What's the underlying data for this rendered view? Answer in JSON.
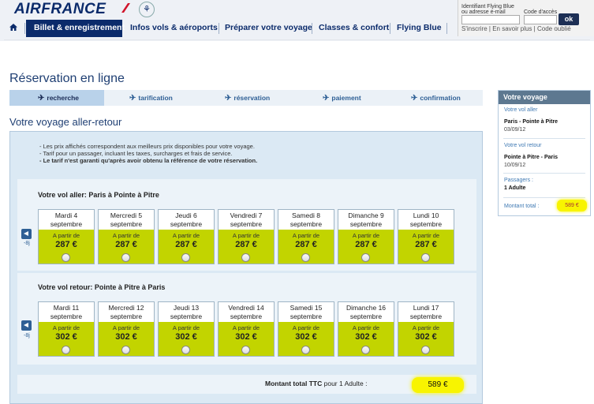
{
  "brand": {
    "logo_text": "AIRFRANCE"
  },
  "login": {
    "id_label": "Identifiant Flying Blue ou adresse e-mail",
    "code_label": "Code d'accès",
    "ok_label": "ok",
    "links": [
      "S'inscrire",
      "En savoir plus",
      "Code oublié"
    ]
  },
  "nav": {
    "home_icon": "home-icon",
    "items": [
      {
        "label": "Billet & enregistrement"
      },
      {
        "label": "Infos vols & aéroports"
      },
      {
        "label": "Préparer votre voyage"
      },
      {
        "label": "Classes & confort"
      },
      {
        "label": "Flying Blue"
      }
    ]
  },
  "page_title": "Réservation en ligne",
  "steps": [
    {
      "label": "recherche"
    },
    {
      "label": "tarification"
    },
    {
      "label": "réservation"
    },
    {
      "label": "paiement"
    },
    {
      "label": "confirmation"
    }
  ],
  "section_title": "Votre voyage aller-retour",
  "info": [
    "- Les prix affichés correspondent aux meilleurs prix disponibles pour votre voyage.",
    "- Tarif pour un passager, incluant les taxes, surcharges et frais de service.",
    "- Le tarif n'est garanti qu'après avoir obtenu la référence de votre réservation."
  ],
  "outbound": {
    "title": "Votre vol aller: Paris à Pointe à Pitre",
    "prev_label": "-8j",
    "from_label": "A partir de",
    "days": [
      {
        "day": "Mardi 4",
        "month": "septembre",
        "price": "287 €"
      },
      {
        "day": "Mercredi 5",
        "month": "septembre",
        "price": "287 €"
      },
      {
        "day": "Jeudi 6",
        "month": "septembre",
        "price": "287 €"
      },
      {
        "day": "Vendredi 7",
        "month": "septembre",
        "price": "287 €"
      },
      {
        "day": "Samedi 8",
        "month": "septembre",
        "price": "287 €"
      },
      {
        "day": "Dimanche 9",
        "month": "septembre",
        "price": "287 €"
      },
      {
        "day": "Lundi 10",
        "month": "septembre",
        "price": "287 €"
      }
    ]
  },
  "return": {
    "title": "Votre vol retour: Pointe à Pitre à Paris",
    "prev_label": "-8j",
    "from_label": "A partir de",
    "days": [
      {
        "day": "Mardi 11",
        "month": "septembre",
        "price": "302 €"
      },
      {
        "day": "Mercredi 12",
        "month": "septembre",
        "price": "302 €"
      },
      {
        "day": "Jeudi 13",
        "month": "septembre",
        "price": "302 €"
      },
      {
        "day": "Vendredi 14",
        "month": "septembre",
        "price": "302 €"
      },
      {
        "day": "Samedi 15",
        "month": "septembre",
        "price": "302 €"
      },
      {
        "day": "Dimanche 16",
        "month": "septembre",
        "price": "302 €"
      },
      {
        "day": "Lundi 17",
        "month": "septembre",
        "price": "302 €"
      }
    ]
  },
  "total": {
    "label_bold": "Montant total TTC",
    "label_rest": "pour 1 Adulte :",
    "value": "589 €"
  },
  "sidebar": {
    "title": "Votre voyage",
    "aller_label": "Votre vol aller",
    "aller_route": "Paris - Pointe à Pitre",
    "aller_date": "03/09/12",
    "retour_label": "Votre vol retour",
    "retour_route": "Pointe à Pitre - Paris",
    "retour_date": "10/09/12",
    "passengers_label": "Passagers :",
    "passengers_value": "1 Adulte",
    "amount_label": "Montant total :",
    "amount_value": "589 €"
  },
  "colors": {
    "navy": "#0b2b6b",
    "price_green": "#c2d400",
    "highlight_yellow": "#f8f400",
    "panel_blue": "#dbe9f4"
  }
}
